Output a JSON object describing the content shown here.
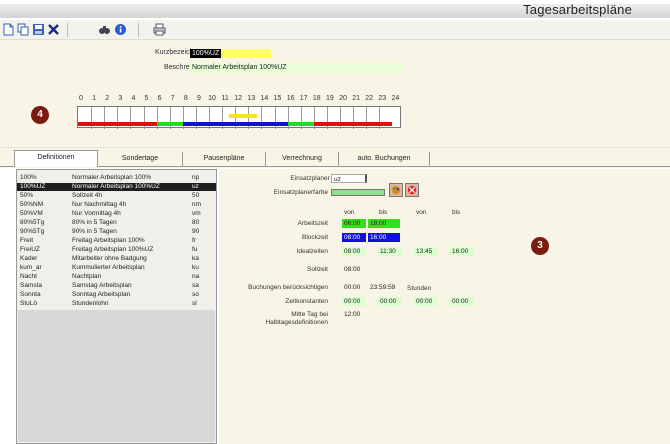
{
  "window": {
    "title": "Tagesarbeitspläne"
  },
  "toolbar": {
    "icons": [
      "new-icon",
      "copy-icon",
      "save-icon",
      "delete-icon",
      "binoculars-icon",
      "info-icon",
      "print-icon"
    ]
  },
  "header": {
    "kurz_label": "Kurzbezeichnung",
    "kurz_value": "100%UZ",
    "besch_label": "Beschreibung",
    "besch_value": "Normaler Arbeitsplan 100%UZ",
    "hours": [
      "0",
      "1",
      "2",
      "3",
      "4",
      "5",
      "6",
      "7",
      "8",
      "9",
      "10",
      "11",
      "12",
      "13",
      "14",
      "15",
      "16",
      "17",
      "18",
      "19",
      "20",
      "21",
      "22",
      "23",
      "24"
    ],
    "badge": "4",
    "bar_colors": {
      "red": "#e01010",
      "green": "#22dd22",
      "blue": "#1010d0",
      "yellow": "#f5e31b"
    }
  },
  "tabs": [
    "Definitionen",
    "Sondertage",
    "Pausenpläne",
    "Verrechnung",
    "auto. Buchungen"
  ],
  "plans": [
    {
      "code": "100%",
      "name": "Normaler Arbeitsplan 100%",
      "short": "np"
    },
    {
      "code": "100%UZ",
      "name": "Normaler Arbeitsplan 100%UZ",
      "short": "uz"
    },
    {
      "code": "50%",
      "name": "Sollzeit 4h",
      "short": "50"
    },
    {
      "code": "50%NM",
      "name": "Nur Nachmittag 4h",
      "short": "nm"
    },
    {
      "code": "50%VM",
      "name": "Nur Vormittag 4h",
      "short": "vm"
    },
    {
      "code": "80%5Tg",
      "name": "80% in 5 Tagen",
      "short": "80"
    },
    {
      "code": "90%5Tg",
      "name": "90% in 5 Tagen",
      "short": "90"
    },
    {
      "code": "Freit",
      "name": "Freitag Arbeitsplan 100%",
      "short": "fr"
    },
    {
      "code": "FreiUZ",
      "name": "Freitag Arbeitsplan 100%UZ",
      "short": "fu"
    },
    {
      "code": "Kader",
      "name": "Mitarbeiter ohne Badgung",
      "short": "ka"
    },
    {
      "code": "kum_ar",
      "name": "Kummulierter Arbeitsplan",
      "short": "ku"
    },
    {
      "code": "Nacht",
      "name": "Nachtplan",
      "short": "na"
    },
    {
      "code": "Samsta",
      "name": "Samstag Arbeitsplan",
      "short": "sa"
    },
    {
      "code": "Sonnta",
      "name": "Sonntag Arbeitsplan",
      "short": "so"
    },
    {
      "code": "StuLö",
      "name": "Stundenlohn",
      "short": "sl"
    }
  ],
  "selected_index": 1,
  "detail": {
    "kuerzel_label": "Einsatzplaner Kürzel",
    "kuerzel_value": "uz",
    "farbe_label": "Einsatzplanerfarbe",
    "col_von": "von",
    "col_bis": "bis",
    "arbeitszeit_label": "Arbeitszeit",
    "arbeitszeit_von": "06:00",
    "arbeitszeit_bis": "18:00",
    "blockzeit_label": "Blockzeit",
    "blockzeit_von": "08:00",
    "blockzeit_bis": "16:00",
    "idealzeiten_label": "Idealzeiten",
    "ideal_1_von": "08:00",
    "ideal_1_bis": "11:30",
    "ideal_2_von": "13:45",
    "ideal_2_bis": "16:00",
    "sollzeit_label": "Sollzeit",
    "sollzeit_value": "08:00",
    "buchungen_label": "Buchungen berücksichtigen",
    "buchungen_von": "00:00",
    "buchungen_bis": "23:59:59",
    "buchungen_unit": "Stunden",
    "zeitkonstanten_label": "Zeitkonstanten",
    "zk_1": "00:00",
    "zk_2": "00:00",
    "zk_3": "00:00",
    "zk_4": "00:00",
    "mitte_label_1": "Mitte Tag bei",
    "mitte_label_2": "Halbtagesdefinitionen",
    "mitte_value": "12:00",
    "badge": "3"
  }
}
